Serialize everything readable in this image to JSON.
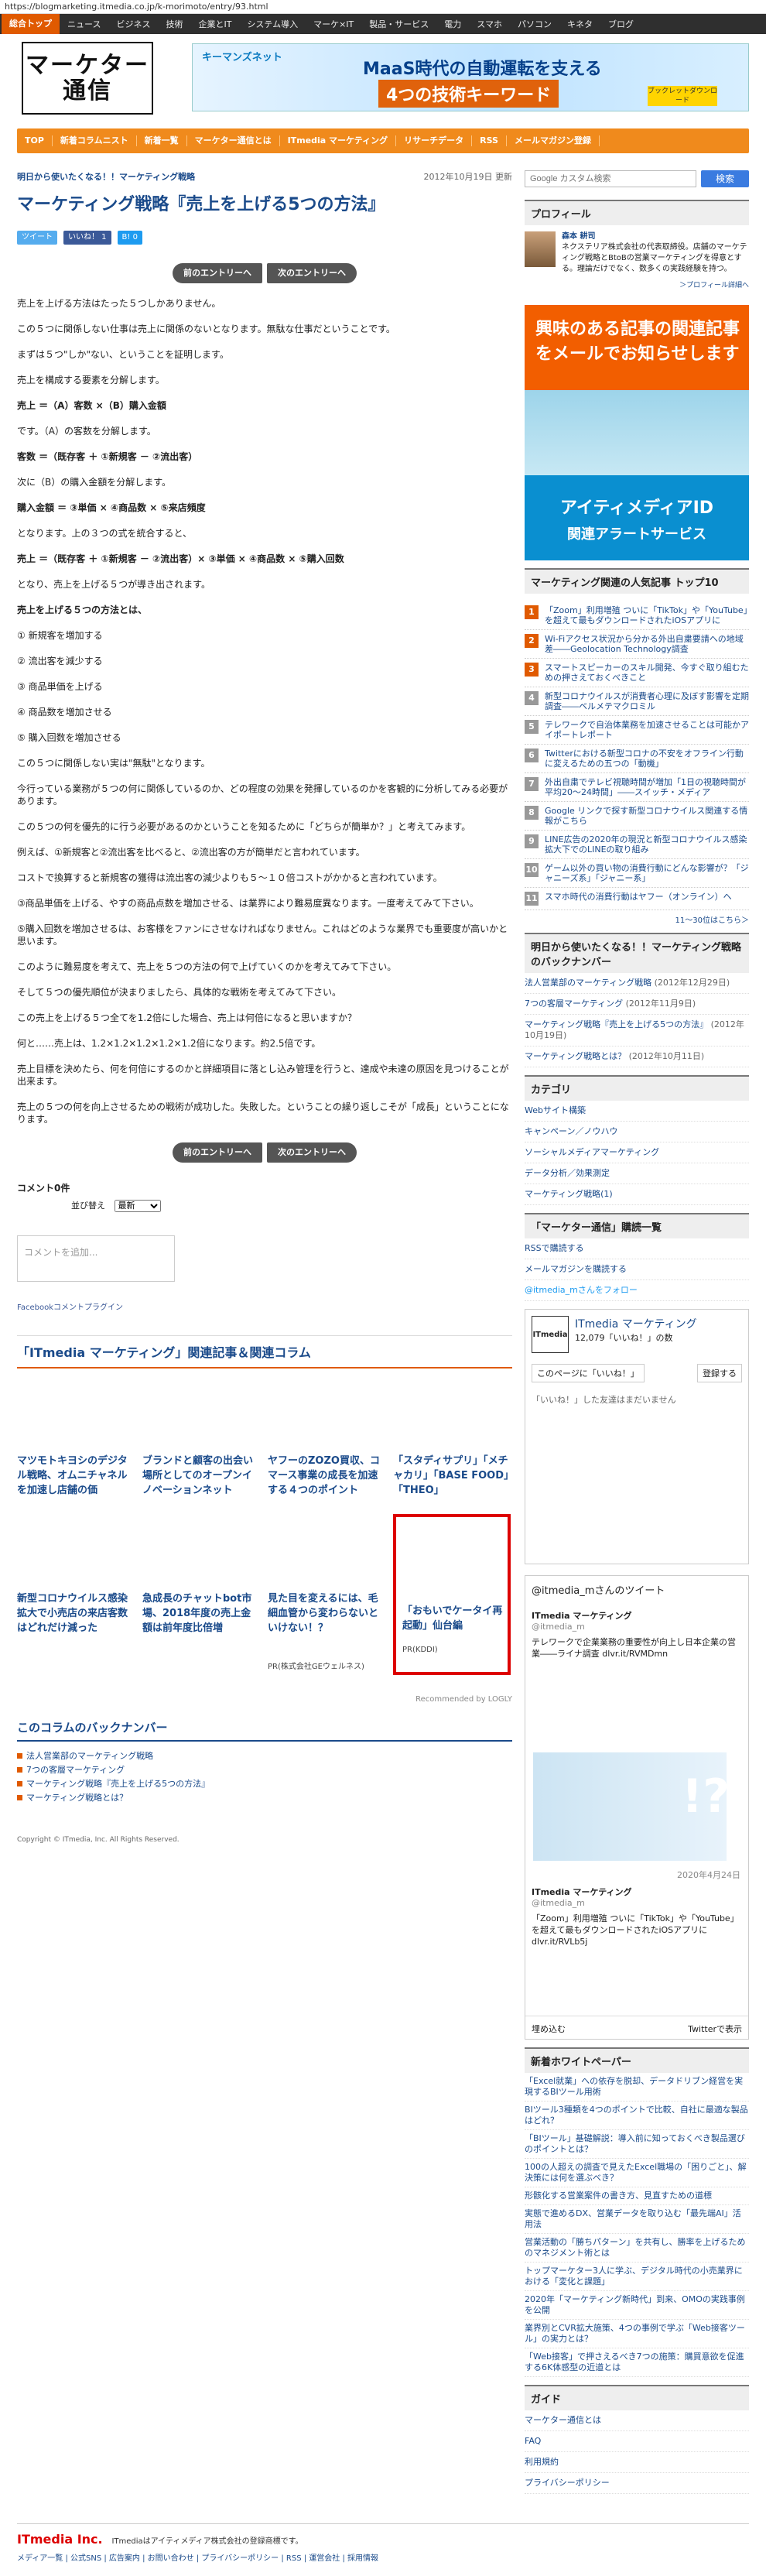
{
  "url": "https://blogmarketing.itmedia.co.jp/k-morimoto/entry/93.html",
  "gnav": [
    "総合トップ",
    "ニュース",
    "ビジネス",
    "技術",
    "企業とIT",
    "システム導入",
    "マーケ×IT",
    "製品・サービス",
    "電力",
    "スマホ",
    "パソコン",
    "キネタ",
    "ブログ"
  ],
  "header": {
    "logo": "マーケター通信",
    "banner_company": "キーマンズネット",
    "banner_h1": "MaaS時代の自動運転を支える",
    "banner_h2": "4つの技術キーワード",
    "banner_dl": "ブックレットダウンロード"
  },
  "snav": [
    "TOP",
    "新着コラムニスト",
    "新着一覧",
    "マーケター通信とは",
    "ITmedia マーケティング",
    "リサーチデータ",
    "RSS",
    "メールマガジン登録"
  ],
  "post": {
    "series": "明日から使いたくなる！！マーケティング戦略",
    "date": "2012年10月19日 更新",
    "title": "マーケティング戦略『売上を上げる5つの方法』",
    "share": [
      "ツイート",
      "いいね！ 1",
      "B! 0"
    ],
    "prev": "前のエントリーへ",
    "next": "次のエントリーへ",
    "paras": [
      "売上を上げる方法はたった５つしかありません。",
      "この５つに関係しない仕事は売上に関係のないとなります。無駄な仕事だということです。",
      "まずは５つ\"しか\"ない、ということを証明します。",
      "売上を構成する要素を分解します。",
      "売上 ＝（A）客数 ×（B）購入金額",
      "です。（A）の客数を分解します。",
      "客数 ＝（既存客 ＋ ①新規客 － ②流出客）",
      "次に（B）の購入金額を分解します。",
      "購入金額 ＝ ③単価 × ④商品数 × ⑤来店頻度",
      "となります。上の３つの式を統合すると、",
      "売上 ＝（既存客 ＋ ①新規客 － ②流出客）× ③単価 × ④商品数 × ⑤購入回数",
      "となり、売上を上げる５つが導き出されます。",
      "売上を上げる５つの方法とは、",
      "① 新規客を増加する",
      "② 流出客を減少する",
      "③ 商品単価を上げる",
      "④ 商品数を増加させる",
      "⑤ 購入回数を増加させる",
      "この５つに関係しない実は\"無駄\"となります。",
      "今行っている業務が５つの何に関係しているのか、どの程度の効果を発揮しているのかを客観的に分析してみる必要があります。",
      "この５つの何を優先的に行う必要があるのかということを知るために「どちらが簡単か？」と考えてみます。",
      "例えば、①新規客と②流出客を比べると、②流出客の方が簡単だと言われています。",
      "コストで換算すると新規客の獲得は流出客の減少よりも５～１０倍コストがかかると言われています。",
      "③商品単価を上げる、やすの商品点数を増加させる、は業界により難易度異なります。一度考えてみて下さい。",
      "⑤購入回数を増加させるは、お客様をファンにさせなければなりません。これはどのような業界でも重要度が高いかと思います。",
      "このように難易度を考えて、売上を５つの方法の何で上げていくのかを考えてみて下さい。",
      "そして５つの優先順位が決まりましたら、具体的な戦術を考えてみて下さい。",
      "この売上を上げる５つ全てを1.2倍にした場合、売上は何倍になると思いますか？",
      "何と……売上は、1.2×1.2×1.2×1.2×1.2倍になります。約2.5倍です。",
      "売上目標を決めたら、何を何倍にするのかと詳細項目に落とし込み管理を行うと、達成や未達の原因を見つけることが出来ます。",
      "売上の５つの何を向上させるための戦術が成功した。失敗した。ということの繰り返しこそが「成長」ということになります。"
    ],
    "bold_index": [
      4,
      6,
      8,
      10,
      12
    ]
  },
  "comments": {
    "count": "コメント0件",
    "sort_label": "並び替え",
    "sort_value": "最新",
    "placeholder": "コメントを追加...",
    "fb": "Facebookコメントプラグイン"
  },
  "related": {
    "heading": "「ITmedia マーケティング」関連記事＆関連コラム",
    "row1": [
      "マツモトキヨシのデジタル戦略、オムニチャネルを加速し店舗の価",
      "ブランドと顧客の出会い場所としてのオープンイノベーションネット",
      "ヤフーのZOZO買収、コマース事業の成長を加速する４つのポイント",
      "「スタディサプリ」「メチャカリ」「BASE FOOD」「THEO」"
    ],
    "row2": [
      "新型コロナウイルス感染拡大で小売店の来店客数はどれだけ減った",
      "急成長のチャットbot市場、2018年度の売上金額は前年度比倍増",
      "見た目を変えるには、毛細血管から変わらないといけない！？"
    ],
    "row2_pr": "PR(株式会社GEウェルネス)",
    "ad_title": "「おもいでケータイ再起動」仙台編",
    "ad_pr": "PR(KDDI)",
    "recby": "Recommended by LOGLY"
  },
  "backnumber": {
    "heading": "このコラムのバックナンバー",
    "items": [
      "法人営業部のマーケティング戦略",
      "7つの客層マーケティング",
      "マーケティング戦略『売上を上げる5つの方法』",
      "マーケティング戦略とは？"
    ]
  },
  "copyright": "Copyright © ITmedia, Inc. All Rights Reserved.",
  "side": {
    "search_placeholder": "Google カスタム検索",
    "search_btn": "検索",
    "profile_h": "プロフィール",
    "profile_name": "森本 耕司",
    "profile_text": "ネクステリア株式会社の代表取締役。店舗のマーケティング戦略とBtoBの営業マーケティングを得意とする。理論だけでなく、数多くの実践経験を持つ。",
    "profile_more": "＞プロフィール詳細へ",
    "alert1": "興味のある記事の関連記事をメールでお知らせします",
    "alert2": "アイティメディアID",
    "alert3": "関連アラートサービス",
    "rank_h": "マーケティング関連の人気記事 トップ10",
    "ranks": [
      "「Zoom」利用増殖 ついに「TikTok」や「YouTube」を超えて最もダウンロードされたiOSアプリに",
      "Wi-Fiアクセス状況から分かる外出自粛要請への地域差――Geolocation Technology調査",
      "スマートスピーカーのスキル開発、今すぐ取り組むための押さえておくべきこと",
      "新型コロナウイルスが消費者心理に及ぼす影響を定期調査――ベルメテマクロミル",
      "テレワークで自治体業務を加速させることは可能かアイポートレポート",
      "Twitterにおける新型コロナの不安をオフライン行動に変えるための五つの「動機」",
      "外出自粛でテレビ視聴時間が増加「1日の視聴時間が平均20～24時間」――スイッチ・メディア",
      "Google リンクで探す新型コロナウイルス関連する情報がこちら",
      "LINE広告の2020年の現況と新型コロナウイルス感染拡大下でのLINEの取り組み",
      "ゲーム以外の買い物の消費行動にどんな影響が？「ジャニーズ系」「ジャニー系」",
      "スマホ時代の消費行動はヤフー（オンライン）へ"
    ],
    "rank_pg": "11～30位はこちら＞",
    "series_h": "明日から使いたくなる！！マーケティング戦略のバックナンバー",
    "series": [
      [
        "法人営業部のマーケティング戦略",
        "(2012年12月29日)"
      ],
      [
        "7つの客層マーケティング",
        "(2012年11月9日)"
      ],
      [
        "マーケティング戦略『売上を上げる5つの方法』",
        "(2012年10月19日)"
      ],
      [
        "マーケティング戦略とは？",
        "(2012年10月11日)"
      ]
    ],
    "cat_h": "カテゴリ",
    "cats": [
      "Webサイト構築",
      "キャンペーン／ノウハウ",
      "ソーシャルメディアマーケティング",
      "データ分析／効果測定",
      "マーケティング戦略(1)"
    ],
    "sub_h": "「マーケター通信」購読一覧",
    "sub": [
      "RSSで購読する",
      "メールマガジンを購読する"
    ],
    "follow": "@itmedia_mさんをフォロー",
    "fb_name": "ITmedia マーケティング",
    "fb_likes": "12,079「いいね！」の数",
    "fb_like_btn": "このページに「いいね！」",
    "fb_reg": "登録する",
    "fb_none": "「いいね！」した友達はまだいません",
    "tw_h": "@itmedia_mさんのツイート",
    "tw_name": "ITmedia マーケティング",
    "tw_handle": "@itmedia_m",
    "tw_t1": "テレワークで企業業務の重要性が向上し日本企業の営業――ライナ調査 dlvr.it/RVMDmn",
    "tw_date": "2020年4月24日",
    "tw_t2": "「Zoom」利用増殖 ついに「TikTok」や「YouTube」を超えて最もダウンロードされたiOSアプリに dlvr.it/RVLb5j",
    "tw_embed": "埋め込む",
    "tw_view": "Twitterで表示",
    "wp_h": "新着ホワイトペーパー",
    "wps": [
      "「Excel就業」への依存を脱却、データドリブン経営を実現するBIツール用術",
      "BIツール3種類を4つのポイントで比較、自社に最適な製品はどれ？",
      "「BIツール」基礎解説：導入前に知っておくべき製品選びのポイントとは？",
      "100の人超えの調査で見えたExcel職場の「困りごと」、解決策には何を選ぶべき？",
      "形骸化する営業案件の書き方、見直すための道標",
      "実態で進めるDX、営業データを取り込む「最先端AI」活用法",
      "営業活動の「勝ちパターン」を共有し、勝率を上げるためのマネジメント術とは",
      "トップマーケター3人に学ぶ、デジタル時代の小売業界における「変化と課題」",
      "2020年「マーケティング新時代」到来、OMOの実践事例を公開",
      "業界別とCVR拡大施策、4つの事例で学ぶ「Web接客ツール」の実力とは？",
      "「Web接客」で押さえるべき7つの施策：購買意欲を促進する6K体感型の近道とは"
    ],
    "guide_h": "ガイド",
    "guide": [
      "マーケター通信とは",
      "FAQ",
      "利用規約",
      "プライバシーポリシー"
    ]
  },
  "footer": {
    "logo": "ITmedia Inc.",
    "text": "ITmediaはアイティメディア株式会社の登録商標です。",
    "links": "メディア一覧 | 公式SNS | 広告案内 | お問い合わせ | プライバシーポリシー | RSS | 運営会社 | 採用情報"
  }
}
